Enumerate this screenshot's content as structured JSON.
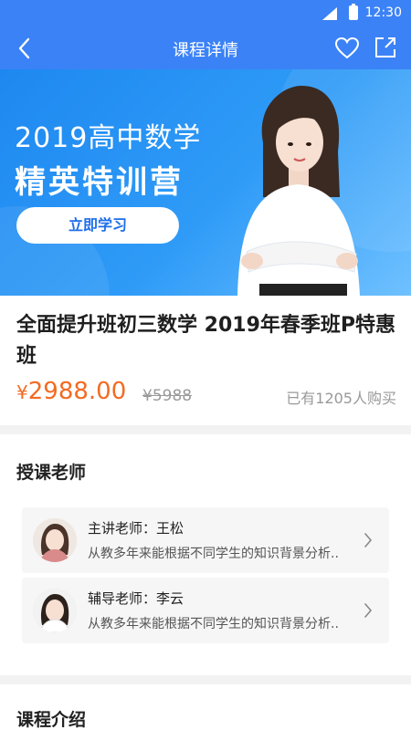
{
  "status_bar": {
    "time": "12:30"
  },
  "nav": {
    "title": "课程详情"
  },
  "banner": {
    "line1": "2019高中数学",
    "line2": "精英特训营",
    "button_label": "立即学习"
  },
  "course": {
    "title": "全面提升班初三数学 2019年春季班P特惠班",
    "currency": "¥",
    "price": "2988.00",
    "original_price": "¥5988",
    "sold_text": "已有1205人购买"
  },
  "teachers_section": {
    "title": "授课老师",
    "items": [
      {
        "name": "主讲老师：王松",
        "desc": "从教多年来能根据不同学生的知识背景分析.."
      },
      {
        "name": "辅导老师：李云",
        "desc": "从教多年来能根据不同学生的知识背景分析.."
      }
    ]
  },
  "intro_section": {
    "title": "课程介绍"
  },
  "colors": {
    "brand": "#3b82f6",
    "price": "#f26b21"
  }
}
